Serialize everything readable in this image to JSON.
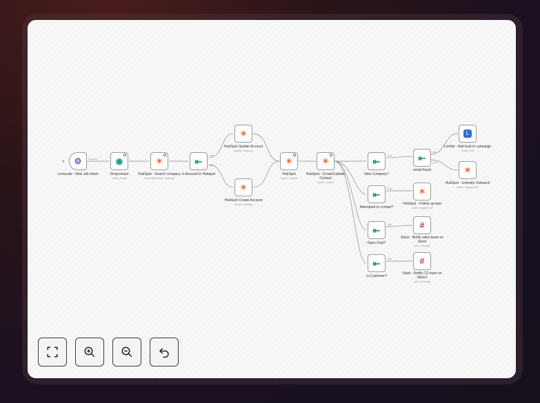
{
  "nodes": {
    "lemscale": {
      "label": "Lemscale - New Job Intent",
      "sub": "",
      "icon": "lemscale-icon"
    },
    "dropcontact": {
      "label": "Dropcontact",
      "sub": "enrich contact",
      "icon": "dropcontact-icon"
    },
    "hs_search": {
      "label": "HubSpot - Search company",
      "sub": "searchByDomain: company",
      "icon": "hubspot-icon"
    },
    "is_account": {
      "label": "Is Account in Hubspot",
      "sub": "",
      "icon": "filter-icon"
    },
    "hs_update_account": {
      "label": "HubSpot Update Account",
      "sub": "update: company",
      "icon": "hubspot-icon"
    },
    "hs_create_account": {
      "label": "HubSpot Create Account",
      "sub": "create: company",
      "icon": "hubspot-icon"
    },
    "hubspot": {
      "label": "HubSpot",
      "sub": "search: contact",
      "icon": "hubspot-icon"
    },
    "hs_upsert_contact": {
      "label": "HubSpot - Create/Update Contact",
      "sub": "upsert: contact",
      "icon": "hubspot-icon"
    },
    "new_company": {
      "label": "New Company?",
      "sub": "",
      "icon": "filter-icon"
    },
    "email_found": {
      "label": "email found",
      "sub": "",
      "icon": "filter-icon"
    },
    "lemlist": {
      "label": "Lemlist - Add lead to campaign",
      "sub": "create: lead",
      "icon": "lemlist-icon"
    },
    "hs_linkedin": {
      "label": "HubSpot - LinkedIn Outreach",
      "sub": "create: engagement",
      "icon": "hubspot-icon"
    },
    "attempted": {
      "label": "Attempted to contact?",
      "sub": "",
      "icon": "filter-icon"
    },
    "hs_follow_up": {
      "label": "HubSpot - Follow up task",
      "sub": "create: engagement",
      "icon": "hubspot-icon"
    },
    "open_deal": {
      "label": "Open Deal?",
      "sub": "",
      "icon": "filter-icon"
    },
    "slack_sales": {
      "label": "Slack - Notify sales team on Slack",
      "sub": "post: message",
      "icon": "slack-icon"
    },
    "is_customer": {
      "label": "Is Customer?",
      "sub": "",
      "icon": "filter-icon"
    },
    "slack_cs": {
      "label": "Slack - Notify CS team on Slack1",
      "sub": "post: message",
      "icon": "slack-icon"
    }
  },
  "edge_labels": {
    "success": "success",
    "true": "true",
    "false": "false"
  },
  "controls": {
    "fit_view": "fit-view-icon",
    "zoom_in": "zoom-in-icon",
    "zoom_out": "zoom-out-icon",
    "undo": "undo-icon"
  },
  "colors": {
    "hubspot": "#ff6a2a",
    "filter": "#2a9a5a",
    "slack": "#e01e5a",
    "lemlist": "#2b6ce0"
  }
}
